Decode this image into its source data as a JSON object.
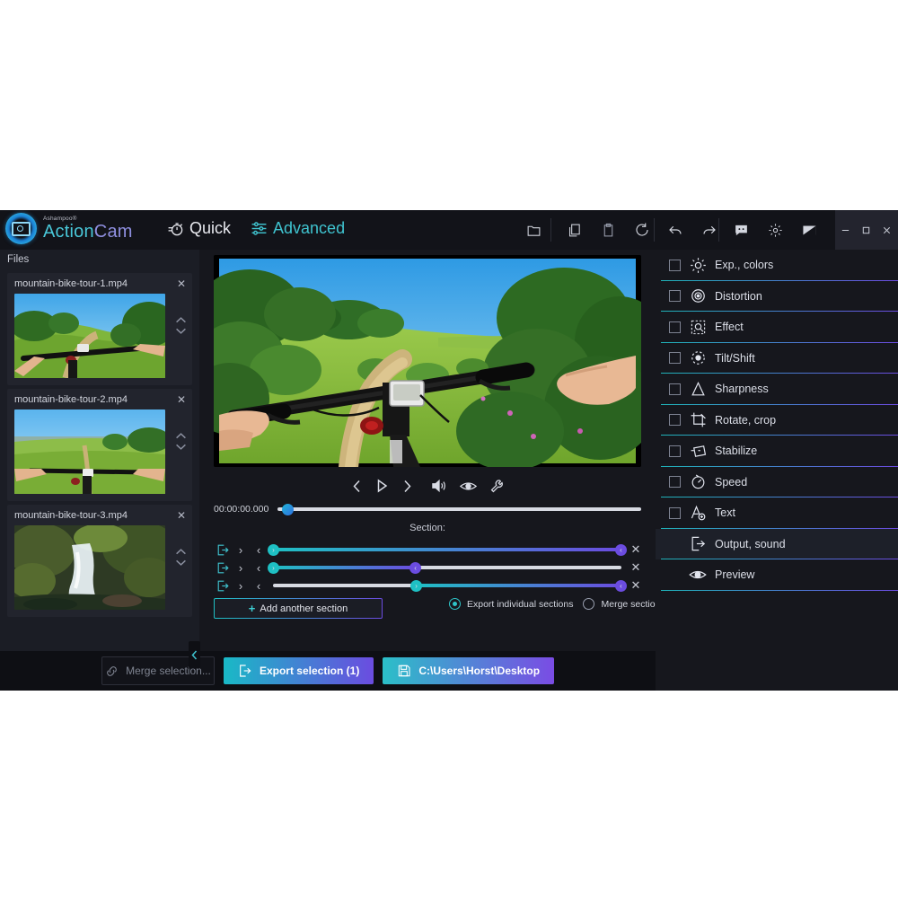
{
  "app": {
    "brand_sup": "Ashampoo®",
    "brand_a": "Action",
    "brand_b": "Cam"
  },
  "modes": [
    {
      "label": "Quick",
      "icon": "stopwatch-icon",
      "active": false
    },
    {
      "label": "Advanced",
      "icon": "sliders-icon",
      "active": true
    }
  ],
  "toolbar": {
    "group1": [
      {
        "name": "open-folder-icon"
      }
    ],
    "group2": [
      {
        "name": "copy-icon"
      },
      {
        "name": "paste-icon"
      },
      {
        "name": "reset-icon"
      }
    ],
    "group3": [
      {
        "name": "undo-icon"
      },
      {
        "name": "redo-icon"
      }
    ],
    "group4": [
      {
        "name": "feedback-icon"
      },
      {
        "name": "settings-gear-icon"
      },
      {
        "name": "theme-icon"
      },
      {
        "name": "info-icon"
      }
    ],
    "window": [
      {
        "name": "minimize-button",
        "glyph": "–"
      },
      {
        "name": "maximize-button",
        "glyph": "□"
      },
      {
        "name": "close-button",
        "glyph": "✕"
      }
    ]
  },
  "sidebar": {
    "header": "Files",
    "files": [
      {
        "name": "mountain-bike-tour-1.mp4",
        "close": "✕"
      },
      {
        "name": "mountain-bike-tour-2.mp4",
        "close": "✕"
      },
      {
        "name": "mountain-bike-tour-3.mp4",
        "close": "✕"
      }
    ],
    "collapse_glyph": "‹"
  },
  "player": {
    "timecode": "00:00:00.000",
    "seek_position_pct": 2,
    "controls": [
      {
        "name": "previous-frame-button",
        "icon": "chevron-left-icon"
      },
      {
        "name": "play-button",
        "icon": "play-icon"
      },
      {
        "name": "next-frame-button",
        "icon": "chevron-right-icon"
      },
      {
        "name": "volume-button",
        "icon": "speaker-icon"
      },
      {
        "name": "preview-eye-button",
        "icon": "eye-icon"
      },
      {
        "name": "tools-button",
        "icon": "wrench-icon"
      }
    ]
  },
  "sections": {
    "label": "Section:",
    "rows": [
      {
        "start_pct": 0,
        "end_pct": 100
      },
      {
        "start_pct": 0,
        "end_pct": 41
      },
      {
        "start_pct": 41,
        "end_pct": 100
      }
    ],
    "add_button": "Add another section",
    "add_plus": "+",
    "export_mode": [
      {
        "label": "Export individual sections",
        "selected": true
      },
      {
        "label": "Merge sections",
        "selected": false
      }
    ]
  },
  "effects": {
    "items": [
      {
        "label": "Exp., colors",
        "icon": "sun-icon",
        "checkbox": true,
        "checked": false,
        "selected": false
      },
      {
        "label": "Distortion",
        "icon": "target-eye-icon",
        "checkbox": true,
        "checked": false,
        "selected": false
      },
      {
        "label": "Effect",
        "icon": "effect-icon",
        "checkbox": true,
        "checked": false,
        "selected": false
      },
      {
        "label": "Tilt/Shift",
        "icon": "tiltshift-icon",
        "checkbox": true,
        "checked": false,
        "selected": false
      },
      {
        "label": "Sharpness",
        "icon": "triangle-icon",
        "checkbox": true,
        "checked": false,
        "selected": false
      },
      {
        "label": "Rotate, crop",
        "icon": "crop-icon",
        "checkbox": true,
        "checked": false,
        "selected": false
      },
      {
        "label": "Stabilize",
        "icon": "stabilize-icon",
        "checkbox": true,
        "checked": false,
        "selected": false
      },
      {
        "label": "Speed",
        "icon": "gauge-icon",
        "checkbox": true,
        "checked": false,
        "selected": false
      },
      {
        "label": "Text",
        "icon": "add-text-icon",
        "checkbox": true,
        "checked": false,
        "selected": false
      },
      {
        "label": "Output, sound",
        "icon": "export-icon",
        "checkbox": false,
        "checked": false,
        "selected": true
      },
      {
        "label": "Preview",
        "icon": "eye-icon",
        "checkbox": false,
        "checked": false,
        "selected": false
      }
    ]
  },
  "bottom": {
    "merge_label": "Merge selection...",
    "export_label": "Export selection (1)",
    "path_label": "C:\\Users\\Horst\\Desktop"
  },
  "colors": {
    "accent_teal": "#2fc4c8",
    "accent_purple": "#6b4ce0",
    "panel_bg": "#16171d",
    "sidebar_bg": "#1b1d25",
    "titlebar_bg": "#121319"
  }
}
